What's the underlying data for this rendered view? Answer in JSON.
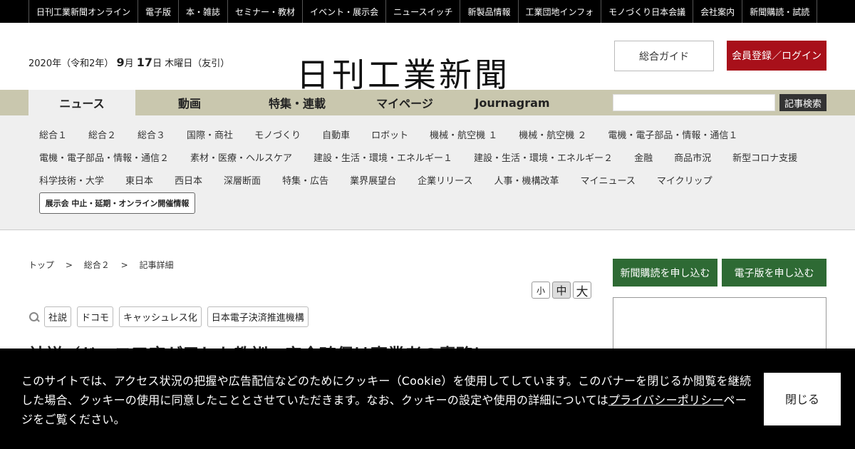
{
  "topbar": {
    "links": [
      "日刊工業新聞オンライン",
      "電子版",
      "本・雑誌",
      "セミナー・教材",
      "イベント・展示会",
      "ニュースイッチ",
      "新製品情報",
      "工業団地インフォ",
      "モノづくり日本会議",
      "会社案内",
      "新聞購読・試読"
    ]
  },
  "header": {
    "date_prefix": "2020年（令和2年）",
    "month": "9",
    "month_unit": "月",
    "day": "17",
    "day_suffix": "日 木曜日（友引）",
    "logo": "日刊工業新聞",
    "guide_label": "総合ガイド",
    "login_label": "会員登録／ログイン"
  },
  "mainnav": {
    "tabs": [
      "ニュース",
      "動画",
      "特集・連載",
      "マイページ",
      "Journagram"
    ],
    "active": "ニュース",
    "search_placeholder": "",
    "search_button": "記事検索"
  },
  "subnav": {
    "row1": [
      "総合１",
      "総合２",
      "総合３",
      "国際・商社",
      "モノづくり",
      "自動車",
      "ロボット",
      "機械・航空機 １",
      "機械・航空機 ２",
      "電機・電子部品・情報・通信１"
    ],
    "row2": [
      "電機・電子部品・情報・通信２",
      "素材・医療・ヘルスケア",
      "建設・生活・環境・エネルギー１",
      "建設・生活・環境・エネルギー２",
      "金融",
      "商品市況",
      "新型コロナ支援"
    ],
    "row3": [
      "科学技術・大学",
      "東日本",
      "西日本",
      "深層断面",
      "特集・広告",
      "業界展望台",
      "企業リリース",
      "人事・機構改革",
      "マイニュース",
      "マイクリップ"
    ],
    "expo_label": "展示会 中止・延期・オンライン開催情報"
  },
  "article": {
    "breadcrumb": [
      "トップ",
      "総合２",
      "記事詳細"
    ],
    "breadcrumb_sep": ">",
    "font_sizes": [
      "小",
      "中",
      "大"
    ],
    "tags": [
      "社説",
      "ドコモ",
      "キャッシュレス化",
      "日本電子決済推進機構"
    ],
    "headline": "社説／ドコモ口座が示した教訓　安全確保は事業者の責務に"
  },
  "sidebar": {
    "subscribe_paper": "新聞購読を申し込む",
    "subscribe_digital": "電子版を申し込む"
  },
  "cookie": {
    "text_before": "このサイトでは、アクセス状況の把握や広告配信などのためにクッキー（Cookie）を使用してしています。このバナーを閉じるか閲覧を継続した場合、クッキーの使用に同意したこととさせていただきます。なお、クッキーの設定や使用の詳細については",
    "policy_link": "プライバシーポリシー",
    "text_after": "ページをご覧ください。",
    "close_label": "閉じる"
  }
}
